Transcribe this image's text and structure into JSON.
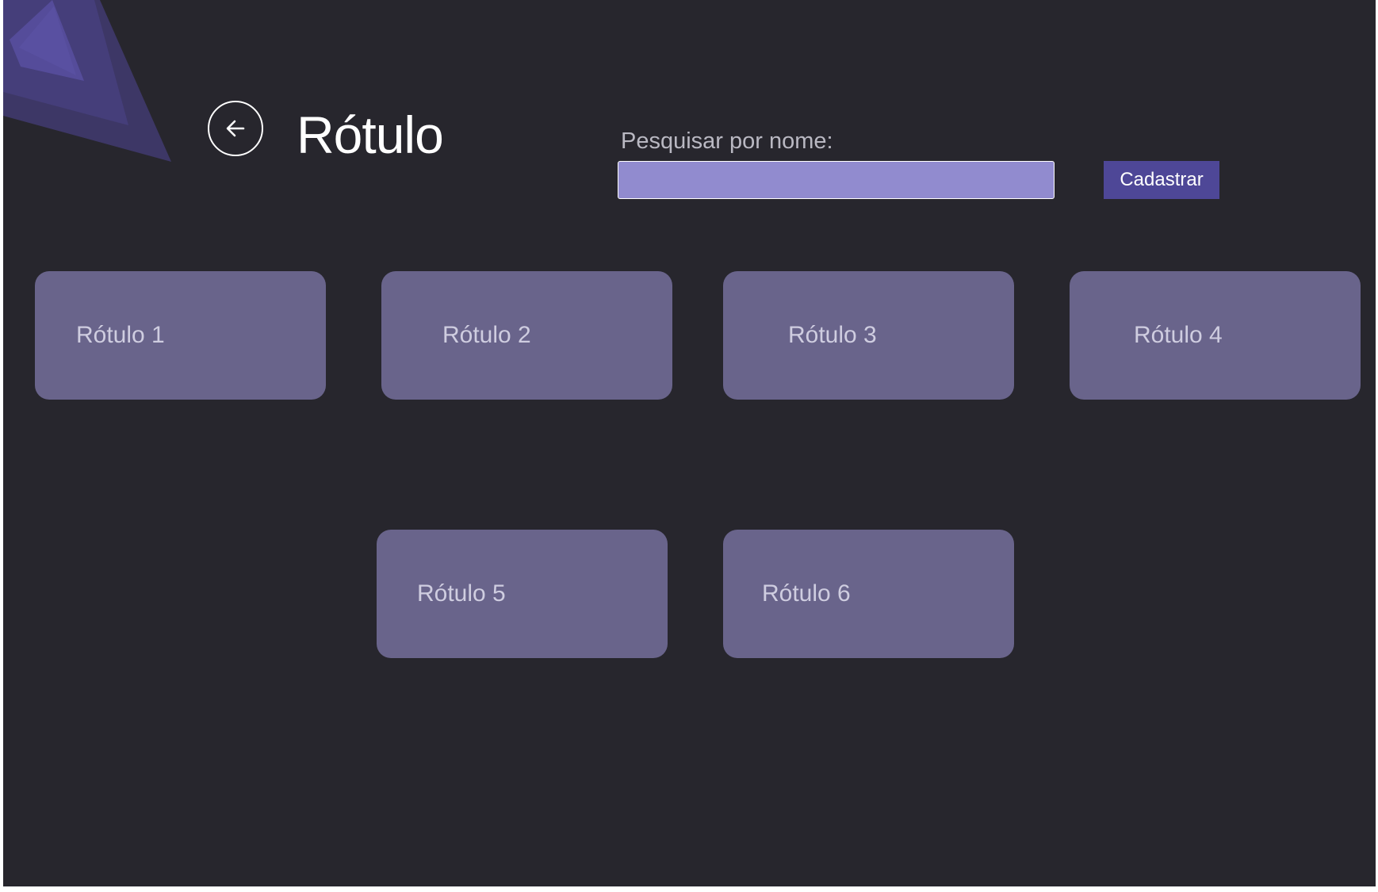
{
  "colors": {
    "background": "#27262d",
    "accent": "#4e4797",
    "input_fill": "#918bcf",
    "card_fill": "#69648b",
    "card_text": "#cfcde0",
    "title_text": "#ffffff",
    "label_text": "#b9b8c2"
  },
  "header": {
    "back_icon": "arrow-left-circle-icon",
    "title": "Rótulo"
  },
  "search": {
    "label": "Pesquisar por nome:",
    "value": "",
    "placeholder": ""
  },
  "actions": {
    "register_label": "Cadastrar"
  },
  "cards": [
    {
      "label": "Rótulo 1"
    },
    {
      "label": "Rótulo 2"
    },
    {
      "label": "Rótulo 3"
    },
    {
      "label": "Rótulo 4"
    },
    {
      "label": "Rótulo 5"
    },
    {
      "label": "Rótulo 6"
    }
  ]
}
